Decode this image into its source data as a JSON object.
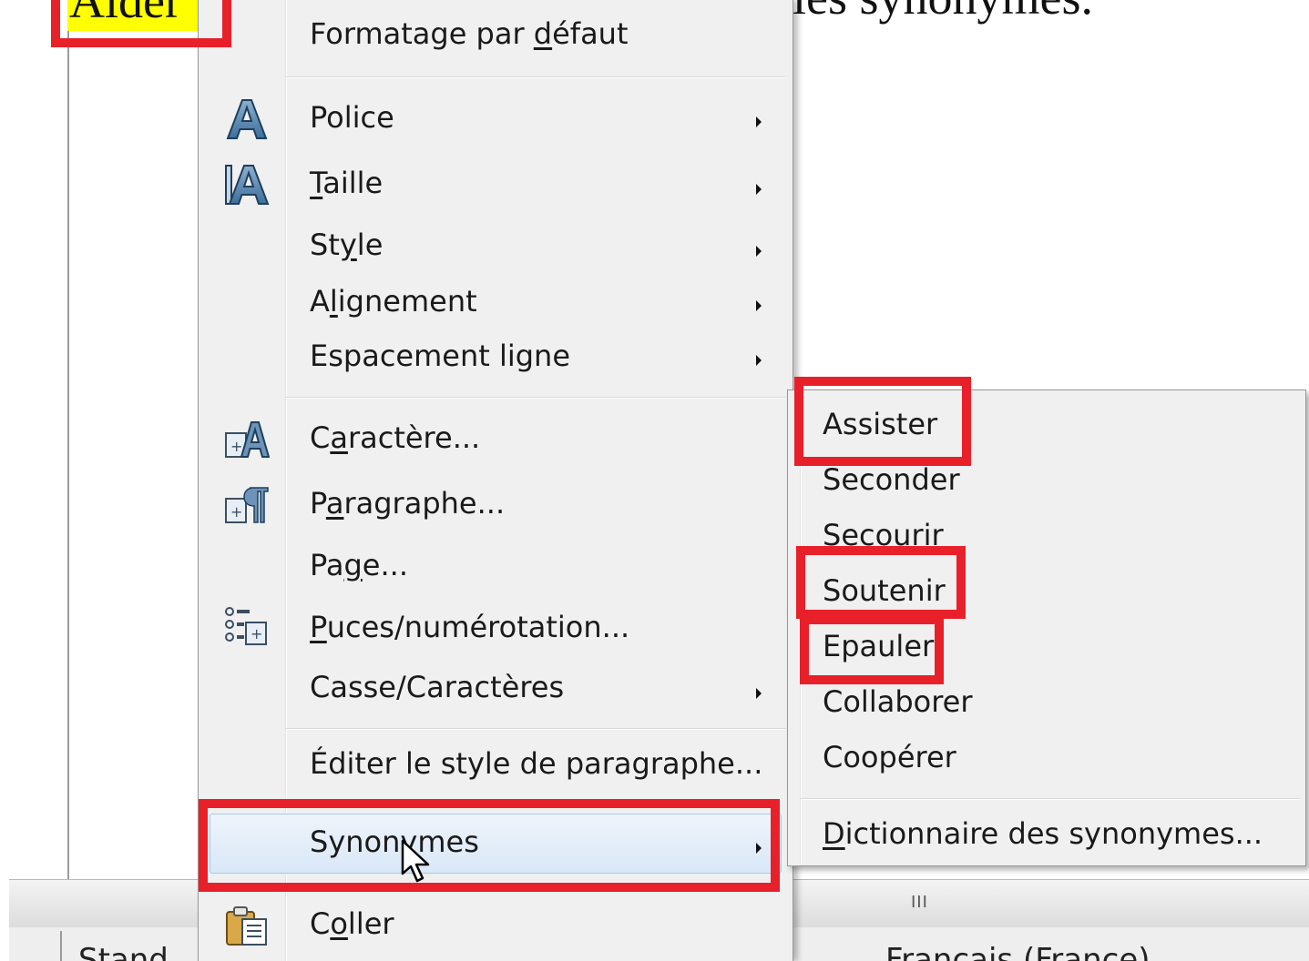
{
  "document": {
    "highlighted_word": "Aider",
    "right_text": "les synonymes."
  },
  "status_bar": {
    "left_text": "Stand",
    "language": "Français (France)"
  },
  "context_menu": {
    "items": [
      {
        "label": "Formatage par défaut",
        "mnemonic_index": 14,
        "icon": null,
        "submenu": false
      },
      {
        "label": "Police",
        "icon": "font-name-icon",
        "submenu": true
      },
      {
        "label": "Taille",
        "mnemonic_index": 0,
        "icon": "font-size-icon",
        "submenu": true
      },
      {
        "label": "Style",
        "mnemonic_index": 2,
        "icon": null,
        "submenu": true
      },
      {
        "label": "Alignement",
        "mnemonic_index": 1,
        "icon": null,
        "submenu": true
      },
      {
        "label": "Espacement ligne",
        "icon": null,
        "submenu": true
      },
      {
        "label": "Caractère...",
        "mnemonic_index": 1,
        "icon": "character-icon",
        "submenu": false
      },
      {
        "label": "Paragraphe...",
        "mnemonic_index": 1,
        "icon": "paragraph-icon",
        "submenu": false
      },
      {
        "label": "Page...",
        "mnemonic_index": 2,
        "icon": null,
        "submenu": false
      },
      {
        "label": "Puces/numérotation...",
        "mnemonic_index": 0,
        "icon": "bullets-numbering-icon",
        "submenu": false
      },
      {
        "label": "Casse/Caractères",
        "icon": null,
        "submenu": true
      },
      {
        "label": "Éditer le style de paragraphe...",
        "icon": null,
        "submenu": false
      },
      {
        "label": "Synonymes",
        "icon": null,
        "submenu": true,
        "highlighted": true
      },
      {
        "label": "Coller",
        "mnemonic_index": 1,
        "icon": "paste-icon",
        "submenu": false
      }
    ]
  },
  "synonyms_submenu": {
    "items": [
      "Assister",
      "Seconder",
      "Secourir",
      "Soutenir",
      "Epauler",
      "Collaborer",
      "Coopérer"
    ],
    "footer": "Dictionnaire des synonymes..."
  },
  "annotation_color": "#e8202a"
}
